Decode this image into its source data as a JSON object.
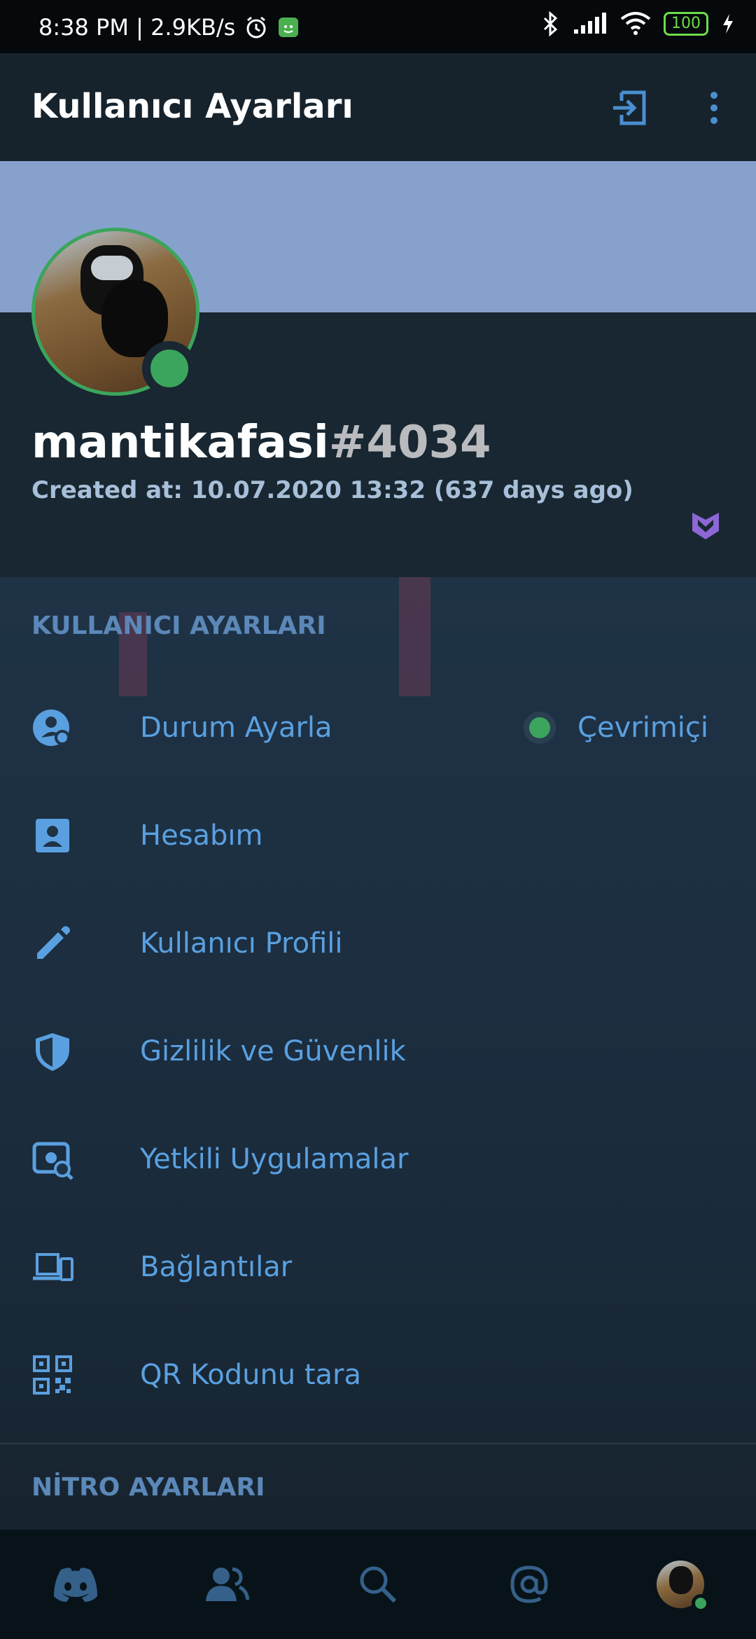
{
  "status_bar": {
    "left_text": "8:38 PM | 2.9KB/s",
    "battery": "100",
    "icons": [
      "alarm-icon",
      "app-notification-icon",
      "bluetooth-icon",
      "signal-icon",
      "wifi-icon",
      "battery-icon",
      "charging-icon"
    ]
  },
  "app_bar": {
    "title": "Kullanıcı Ayarları",
    "actions": [
      "logout-icon",
      "more-vertical-icon"
    ]
  },
  "profile": {
    "username": "mantikafasi",
    "discriminator": "#4034",
    "created": "Created at: 10.07.2020 13:32 (637 days ago)",
    "status_color": "#3ba55d",
    "badge_icon": "hypesquad-badge-icon"
  },
  "sections": {
    "user_settings": "KULLANICI AYARLARI",
    "nitro_settings": "NİTRO AYARLARI"
  },
  "rows": [
    {
      "label": "Durum Ayarla",
      "icon": "status-person-icon",
      "value": "Çevrimiçi"
    },
    {
      "label": "Hesabım",
      "icon": "account-card-icon"
    },
    {
      "label": "Kullanıcı Profili",
      "icon": "pencil-icon"
    },
    {
      "label": "Gizlilik ve Güvenlik",
      "icon": "shield-icon"
    },
    {
      "label": "Yetkili Uygulamalar",
      "icon": "authorized-apps-icon"
    },
    {
      "label": "Bağlantılar",
      "icon": "devices-icon"
    },
    {
      "label": "QR Kodunu tara",
      "icon": "qr-code-icon"
    }
  ],
  "bottom_nav": [
    "discord-home-icon",
    "friends-icon",
    "search-icon",
    "mentions-icon",
    "user-avatar"
  ],
  "colors": {
    "accent": "#5aa0e0",
    "online": "#3ba55d",
    "banner": "#86a2cc",
    "section_header": "#5b88b8"
  }
}
